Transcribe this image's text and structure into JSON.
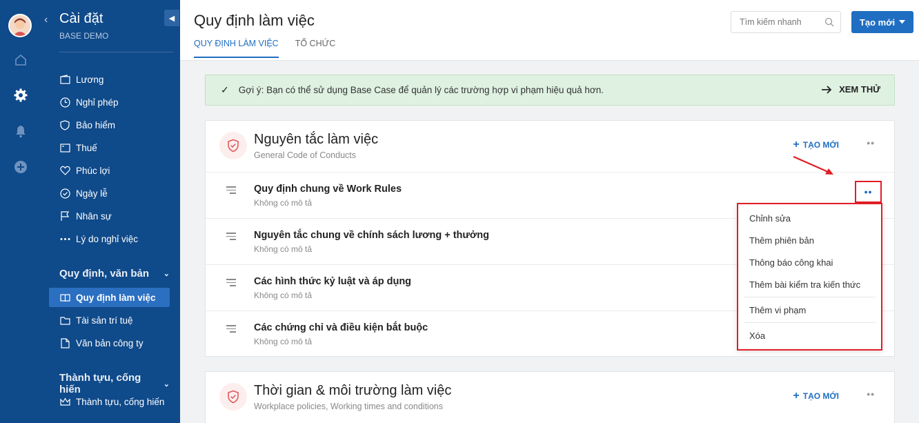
{
  "sidebar": {
    "title": "Cài đặt",
    "subtitle": "BASE DEMO",
    "items": [
      {
        "label": "Lương",
        "icon": "wallet-icon"
      },
      {
        "label": "Nghỉ phép",
        "icon": "clock-icon"
      },
      {
        "label": "Bảo hiểm",
        "icon": "shield-icon"
      },
      {
        "label": "Thuế",
        "icon": "receipt-icon"
      },
      {
        "label": "Phúc lợi",
        "icon": "heart-icon"
      },
      {
        "label": "Ngày lễ",
        "icon": "check-circle-icon"
      },
      {
        "label": "Nhân sự",
        "icon": "flag-icon"
      },
      {
        "label": "Lý do nghỉ việc",
        "icon": "dots-icon"
      }
    ],
    "section_rules": "Quy định, văn bản",
    "rules_items": [
      {
        "label": "Quy định làm việc",
        "icon": "book-icon",
        "active": true
      },
      {
        "label": "Tài sản trí tuệ",
        "icon": "folder-icon"
      },
      {
        "label": "Văn bản công ty",
        "icon": "document-icon"
      }
    ],
    "section_achieve": "Thành tựu, cống hiến",
    "achieve_items": [
      {
        "label": "Thành tựu, cống hiến",
        "icon": "crown-icon"
      }
    ]
  },
  "header": {
    "title": "Quy định làm việc",
    "tabs": [
      "QUY ĐỊNH LÀM VIỆC",
      "TỔ CHỨC"
    ],
    "search_placeholder": "Tìm kiếm nhanh",
    "new_button": "Tạo mới"
  },
  "hint": {
    "text": "Gợi ý: Bạn có thể sử dụng Base Case để quản lý các trường hợp vi phạm hiệu quả hơn.",
    "action": "XEM THỬ"
  },
  "cards": [
    {
      "title": "Nguyên tắc làm việc",
      "subtitle": "General Code of Conducts",
      "add_label": "TẠO MỚI",
      "rows": [
        {
          "title": "Quy định chung về Work Rules",
          "desc": "Không có mô tả"
        },
        {
          "title": "Nguyên tắc chung về chính sách lương + thưởng",
          "desc": "Không có mô tả"
        },
        {
          "title": "Các hình thức kỷ luật và áp dụng",
          "desc": "Không có mô tả"
        },
        {
          "title": "Các chứng chỉ và điều kiện bắt buộc",
          "desc": "Không có mô tả"
        }
      ]
    },
    {
      "title": "Thời gian & môi trường làm việc",
      "subtitle": "Workplace policies, Working times and conditions",
      "add_label": "TẠO MỚI"
    }
  ],
  "dropdown": {
    "items": [
      "Chỉnh sửa",
      "Thêm phiên bản",
      "Thông báo công khai",
      "Thêm bài kiểm tra kiến thức",
      "Thêm vi phạm",
      "Xóa"
    ]
  },
  "colors": {
    "sidebar": "#0f4a8a",
    "accent": "#1f6ec2",
    "highlight": "#e21d24",
    "hint_bg": "#dff1e1"
  }
}
